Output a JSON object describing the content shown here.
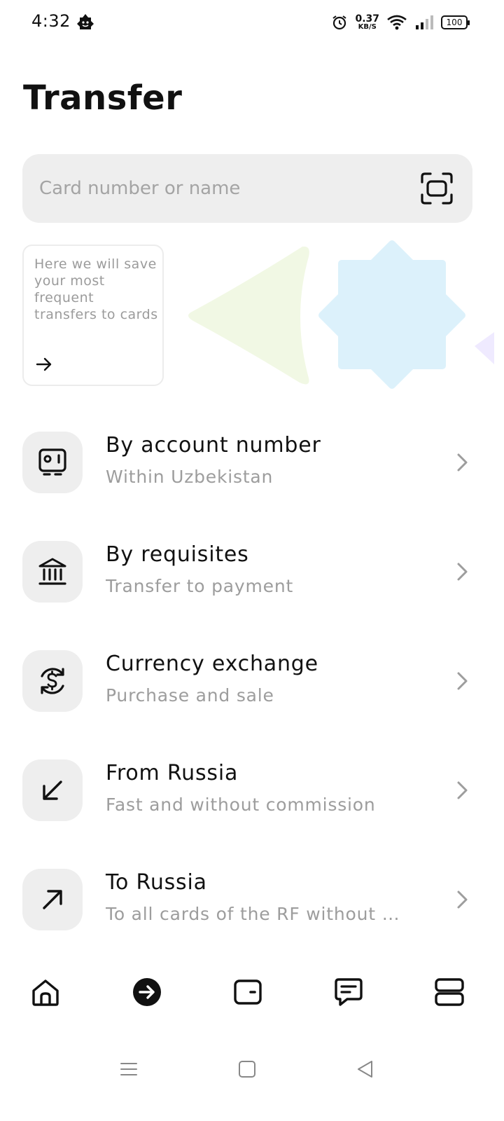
{
  "status_bar": {
    "time": "4:32",
    "net_speed_value": "0.37",
    "net_speed_unit": "KB/S",
    "battery": "100",
    "icons": [
      "app-notification-icon",
      "alarm-icon",
      "wifi-icon",
      "signal-icon",
      "battery-icon"
    ]
  },
  "page": {
    "title": "Transfer"
  },
  "search": {
    "placeholder": "Card number or name",
    "value": "",
    "action_icon": "scan-icon"
  },
  "favorites": {
    "hint": "Here we will save your most frequent transfers to cards",
    "arrow_icon": "arrow-right-icon"
  },
  "decor_colors": {
    "green_shape": "#f1f8e4",
    "blue_shape": "#dcf1fb",
    "purple_shape": "#efeaff"
  },
  "transfer_options": [
    {
      "title": "By account number",
      "subtitle": "Within Uzbekistan",
      "icon": "account-card-icon"
    },
    {
      "title": "By requisites",
      "subtitle": "Transfer to payment",
      "icon": "bank-icon"
    },
    {
      "title": "Currency exchange",
      "subtitle": "Purchase and sale",
      "icon": "currency-exchange-icon"
    },
    {
      "title": "From Russia",
      "subtitle": "Fast and without commission",
      "icon": "arrow-down-left-icon"
    },
    {
      "title": "To Russia",
      "subtitle": "To all cards of the RF without …",
      "icon": "arrow-up-right-icon"
    }
  ],
  "bottom_nav": {
    "items": [
      "home",
      "transfer",
      "wallet",
      "chat",
      "services"
    ],
    "active": "transfer"
  },
  "system_nav": [
    "menu",
    "home",
    "back"
  ],
  "colors": {
    "text_primary": "#111111",
    "text_secondary": "#9d9d9d",
    "surface": "#eeeeee"
  }
}
